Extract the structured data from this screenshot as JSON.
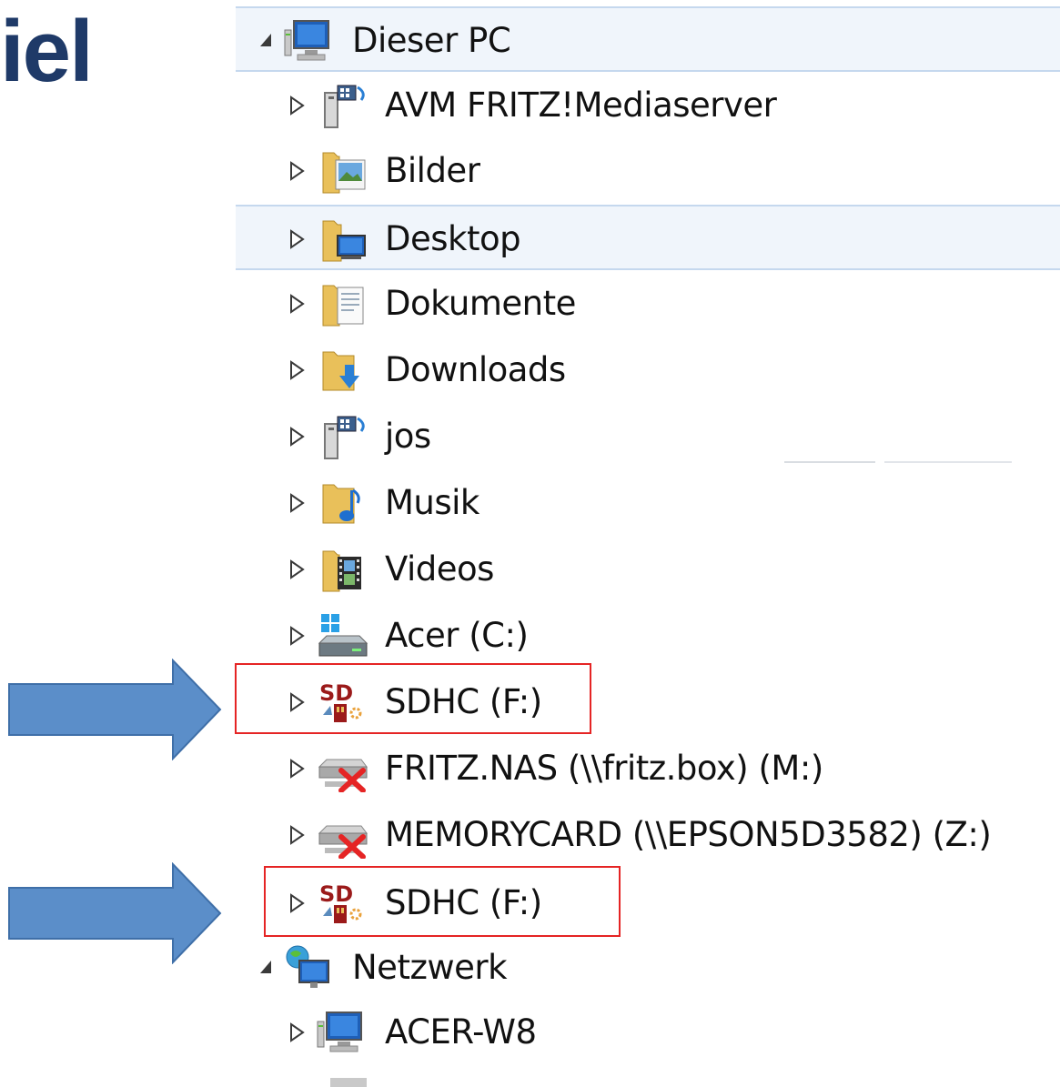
{
  "slide": {
    "title_fragment": "iel"
  },
  "tree": {
    "computer_label": "Dieser PC",
    "computer_children": [
      {
        "label": "AVM FRITZ!Mediaserver",
        "icon": "media-server-icon"
      },
      {
        "label": "Bilder",
        "icon": "pictures-folder-icon"
      },
      {
        "label": "Desktop",
        "icon": "desktop-folder-icon"
      },
      {
        "label": "Dokumente",
        "icon": "documents-folder-icon"
      },
      {
        "label": "Downloads",
        "icon": "downloads-folder-icon"
      },
      {
        "label": "jos",
        "icon": "media-server-icon"
      },
      {
        "label": "Musik",
        "icon": "music-folder-icon"
      },
      {
        "label": "Videos",
        "icon": "videos-folder-icon"
      },
      {
        "label": "Acer (C:)",
        "icon": "system-drive-icon"
      },
      {
        "label": "SDHC (F:)",
        "icon": "sd-card-icon"
      },
      {
        "label": "FRITZ.NAS (\\\\fritz.box) (M:)",
        "icon": "disconnected-network-drive-icon"
      },
      {
        "label": "MEMORYCARD (\\\\EPSON5D3582) (Z:)",
        "icon": "disconnected-network-drive-icon"
      },
      {
        "label": "SDHC (F:)",
        "icon": "sd-card-icon"
      }
    ],
    "network_label": "Netzwerk",
    "network_children": [
      {
        "label": "ACER-W8",
        "icon": "computer-icon"
      }
    ]
  },
  "colors": {
    "title": "#1f3a68",
    "highlight": "#f0f5fb",
    "highlight_border": "#c5d8ee",
    "annotation_box": "#e52424",
    "arrow_fill": "#5b8ec9",
    "arrow_stroke": "#3f6fa8"
  }
}
